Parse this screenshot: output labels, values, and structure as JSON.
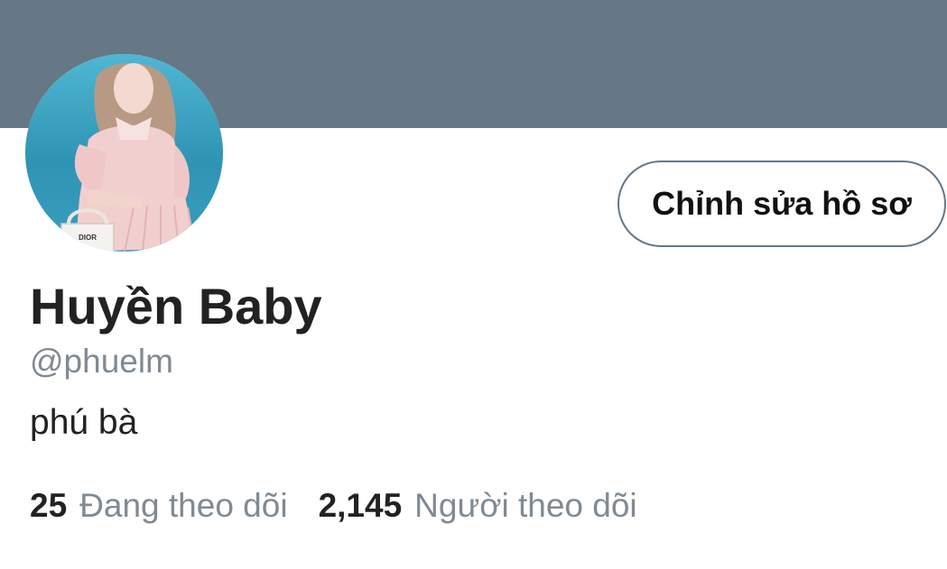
{
  "profile": {
    "display_name": "Huyền Baby",
    "handle": "@phuelm",
    "bio": "phú bà",
    "edit_button_label": "Chỉnh sửa hồ sơ",
    "avatar_caption": "DIOR"
  },
  "stats": {
    "following_count": "25",
    "following_label": "Đang theo dõi",
    "followers_count": "2,145",
    "followers_label": "Người theo dõi"
  },
  "colors": {
    "banner": "#667786",
    "button_border": "#657786",
    "muted_text": "#7f8a94"
  }
}
